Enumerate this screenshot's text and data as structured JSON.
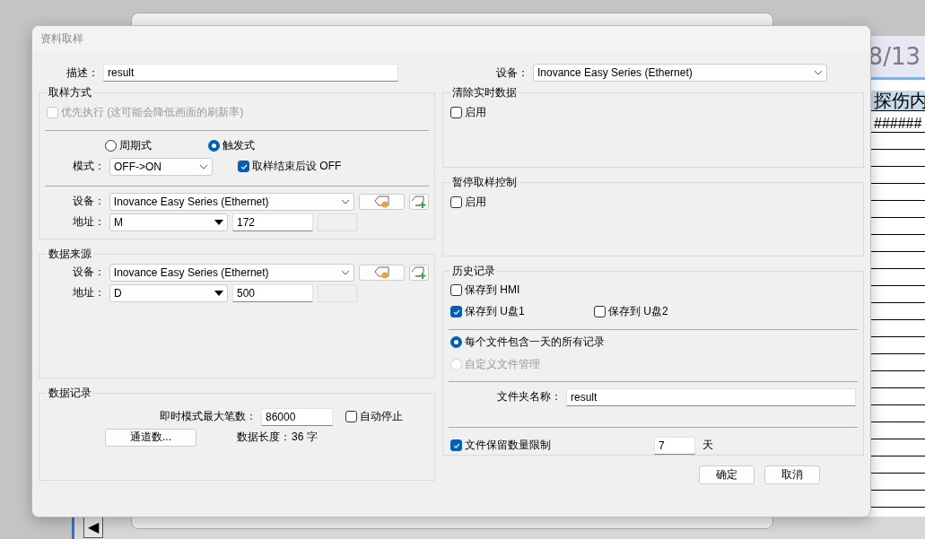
{
  "background_app": {
    "date": "8/13",
    "header": "探伤内",
    "cell": "######",
    "nav_button": "◀"
  },
  "dialog": {
    "title": "资料取样",
    "description": {
      "label": "描述：",
      "value": "result"
    },
    "sampling_method": {
      "title": "取样方式",
      "priority": {
        "label": "优先执行 (这可能会降低画面的刷新率)",
        "checked": false,
        "disabled": true
      },
      "modes": [
        {
          "label": "周期式",
          "selected": false
        },
        {
          "label": "触发式",
          "selected": true
        }
      ],
      "mode": {
        "label": "模式：",
        "value": "OFF->ON"
      },
      "reset_off": {
        "label": "取样结束后设 OFF",
        "checked": true
      },
      "device": {
        "label": "设备：",
        "value": "Inovance Easy Series (Ethernet)"
      },
      "address": {
        "label": "地址：",
        "type": "M",
        "value": "172"
      }
    },
    "data_source": {
      "title": "数据来源",
      "device": {
        "label": "设备：",
        "value": "Inovance Easy Series (Ethernet)"
      },
      "address": {
        "label": "地址：",
        "type": "D",
        "value": "500"
      }
    },
    "data_log": {
      "title": "数据记录",
      "max_label": "即时模式最大笔数：",
      "max_value": "86000",
      "auto_stop": {
        "label": "自动停止",
        "checked": false
      },
      "channels_button": "通道数...",
      "length_label": "数据长度：",
      "length_value": "36 字"
    },
    "device": {
      "label": "设备：",
      "value": "Inovance Easy Series (Ethernet)"
    },
    "clear_realtime": {
      "title": "清除实时数据",
      "enable": {
        "label": "启用",
        "checked": false
      }
    },
    "pause_control": {
      "title": "暂停取样控制",
      "enable": {
        "label": "启用",
        "checked": false
      }
    },
    "history": {
      "title": "历史记录",
      "targets": [
        {
          "label": "保存到 HMI",
          "checked": false
        },
        {
          "label": "保存到 U盘1",
          "checked": true
        },
        {
          "label": "保存到 U盘2",
          "checked": false
        }
      ],
      "file_modes": [
        {
          "label": "每个文件包含一天的所有记录",
          "selected": true,
          "disabled": false
        },
        {
          "label": "自定义文件管理",
          "selected": false,
          "disabled": true
        }
      ],
      "folder": {
        "label": "文件夹名称：",
        "value": "result"
      },
      "retention": {
        "label": "文件保留数量限制",
        "checked": true,
        "value": "7",
        "unit": "天"
      }
    },
    "buttons": [
      "确定",
      "取消"
    ]
  }
}
